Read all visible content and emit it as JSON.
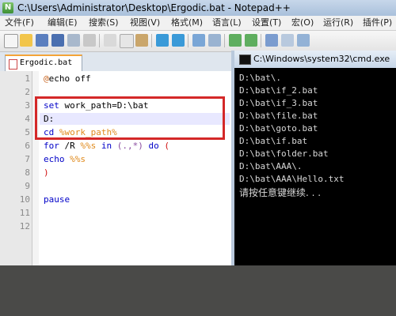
{
  "window": {
    "title": "C:\\Users\\Administrator\\Desktop\\Ergodic.bat - Notepad++"
  },
  "menu": [
    "文件(F)",
    "编辑(E)",
    "搜索(S)",
    "视图(V)",
    "格式(M)",
    "语言(L)",
    "设置(T)",
    "宏(O)",
    "运行(R)",
    "插件(P)"
  ],
  "tab": {
    "label": "Ergodic.bat"
  },
  "editor": {
    "line_numbers": [
      "1",
      "2",
      "3",
      "4",
      "5",
      "6",
      "7",
      "8",
      "9",
      "10",
      "11",
      "12"
    ],
    "code": {
      "l1_at": "@",
      "l1_text": "echo off",
      "l3_kw": "set",
      "l3_text": " work_path=D:\\bat",
      "l4_text": "D:",
      "l5_kw": "cd",
      "l5_var": "%work_path%",
      "l6_kw": "for",
      "l6_a": " /R ",
      "l6_var": "%%s",
      "l6_in": " in ",
      "l6_paren": "(.,*)",
      "l6_do": " do ",
      "l6_open": "(",
      "l7_kw": "echo",
      "l7_var": "%%s",
      "l8_text": ")",
      "l10_kw": "pause"
    }
  },
  "cmd": {
    "title": "C:\\Windows\\system32\\cmd.exe",
    "lines": [
      "D:\\bat\\.",
      "D:\\bat\\if_2.bat",
      "D:\\bat\\if_3.bat",
      "D:\\bat\\file.bat",
      "D:\\bat\\goto.bat",
      "D:\\bat\\if.bat",
      "D:\\bat\\folder.bat",
      "D:\\bat\\AAA\\.",
      "D:\\bat\\AAA\\Hello.txt"
    ],
    "prompt": "请按任意键继续. . ."
  },
  "colors": {
    "highlight_box": "#d42828",
    "keyword": "#0000c8",
    "variable": "#e08a1c",
    "cmd_text": "#d8d8d8"
  },
  "icons": [
    "new-file-icon",
    "open-icon",
    "save-icon",
    "save-all-icon",
    "close-icon",
    "print-icon",
    "cut-icon",
    "copy-icon",
    "paste-icon",
    "undo-icon",
    "redo-icon",
    "find-icon",
    "replace-icon",
    "zoom-in-icon",
    "zoom-out-icon",
    "sync-icon",
    "wrap-icon",
    "indent-icon"
  ]
}
